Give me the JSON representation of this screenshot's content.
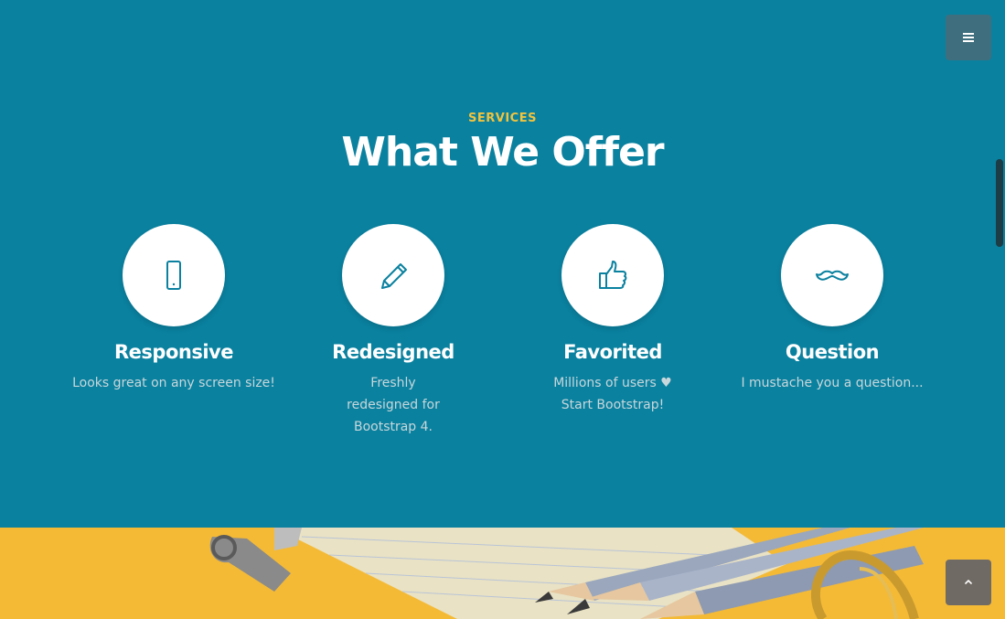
{
  "header": {
    "menu_icon": "hamburger-icon"
  },
  "services": {
    "eyebrow": "SERVICES",
    "title": "What We Offer",
    "items": [
      {
        "icon": "smartphone-icon",
        "name": "Responsive",
        "description": "Looks great on any screen size!"
      },
      {
        "icon": "pencil-icon",
        "name": "Redesigned",
        "description": "Freshly redesigned for Bootstrap 4."
      },
      {
        "icon": "thumbs-up-icon",
        "name": "Favorited",
        "description_before": "Millions of users",
        "description_icon": "heart-icon",
        "description_after": "Start Bootstrap!"
      },
      {
        "icon": "mustache-icon",
        "name": "Question",
        "description": "I mustache you a question..."
      }
    ]
  },
  "colors": {
    "background": "#0a819f",
    "accent": "#f2c33d",
    "photo_background": "#f4ba36"
  },
  "footer": {
    "back_to_top_icon": "chevron-up-icon"
  }
}
